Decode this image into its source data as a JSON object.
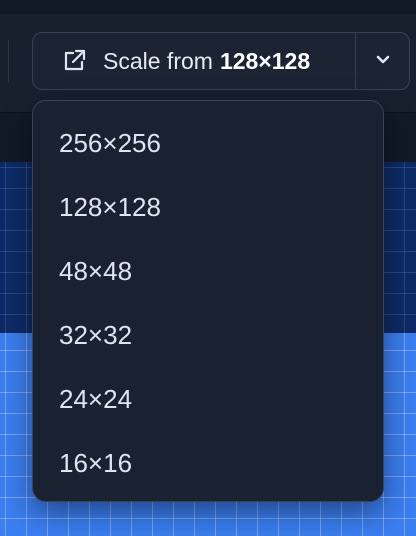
{
  "toolbar": {
    "scale_prefix": "Scale from",
    "scale_value": "128×128"
  },
  "size_menu": {
    "items": [
      {
        "label": "256×256"
      },
      {
        "label": "128×128"
      },
      {
        "label": "48×48"
      },
      {
        "label": "32×32"
      },
      {
        "label": "24×24"
      },
      {
        "label": "16×16"
      }
    ]
  },
  "icons": {
    "scale": "external-link-icon",
    "dropdown": "chevron-down-icon"
  },
  "colors": {
    "panel": "#1c2433",
    "menu_background": "#1a2130",
    "canvas_dark": "#0e2a66",
    "canvas_fill": "#3b7ef0",
    "text": "#dfe5ee"
  }
}
